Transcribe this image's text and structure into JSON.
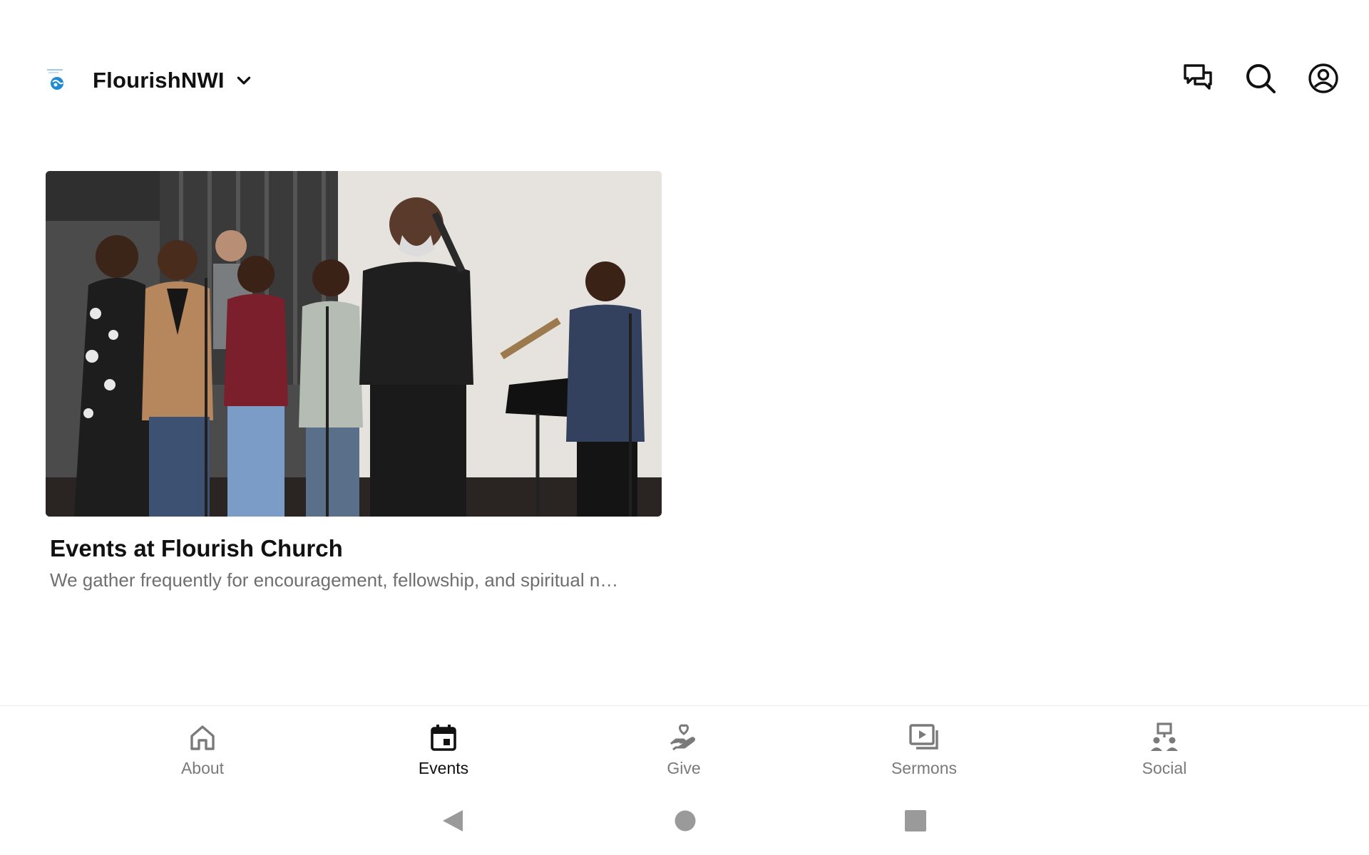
{
  "header": {
    "org_name": "FlourishNWI",
    "icons": {
      "logo": "church-logo-icon",
      "dropdown": "chevron-down-icon",
      "messages": "chat-icon",
      "search": "search-icon",
      "profile": "account-icon"
    }
  },
  "event_card": {
    "title": "Events at Flourish Church",
    "description": "We gather frequently for encouragement, fellowship, and spiritual n…",
    "image": "worship-team-singing-photo"
  },
  "bottom_nav": {
    "items": [
      {
        "label": "About",
        "icon": "home-icon",
        "active": false
      },
      {
        "label": "Events",
        "icon": "calendar-icon",
        "active": true
      },
      {
        "label": "Give",
        "icon": "giving-hand-heart-icon",
        "active": false
      },
      {
        "label": "Sermons",
        "icon": "video-library-icon",
        "active": false
      },
      {
        "label": "Social",
        "icon": "community-icon",
        "active": false
      }
    ]
  },
  "system_nav": {
    "back": "back-triangle-icon",
    "home": "home-circle-icon",
    "recents": "recents-square-icon"
  },
  "colors": {
    "text_primary": "#111111",
    "text_secondary": "#6f6f6f",
    "nav_inactive": "#7a7a7a",
    "system_nav": "#9a9a9a",
    "logo_blue": "#1e8bd0"
  }
}
